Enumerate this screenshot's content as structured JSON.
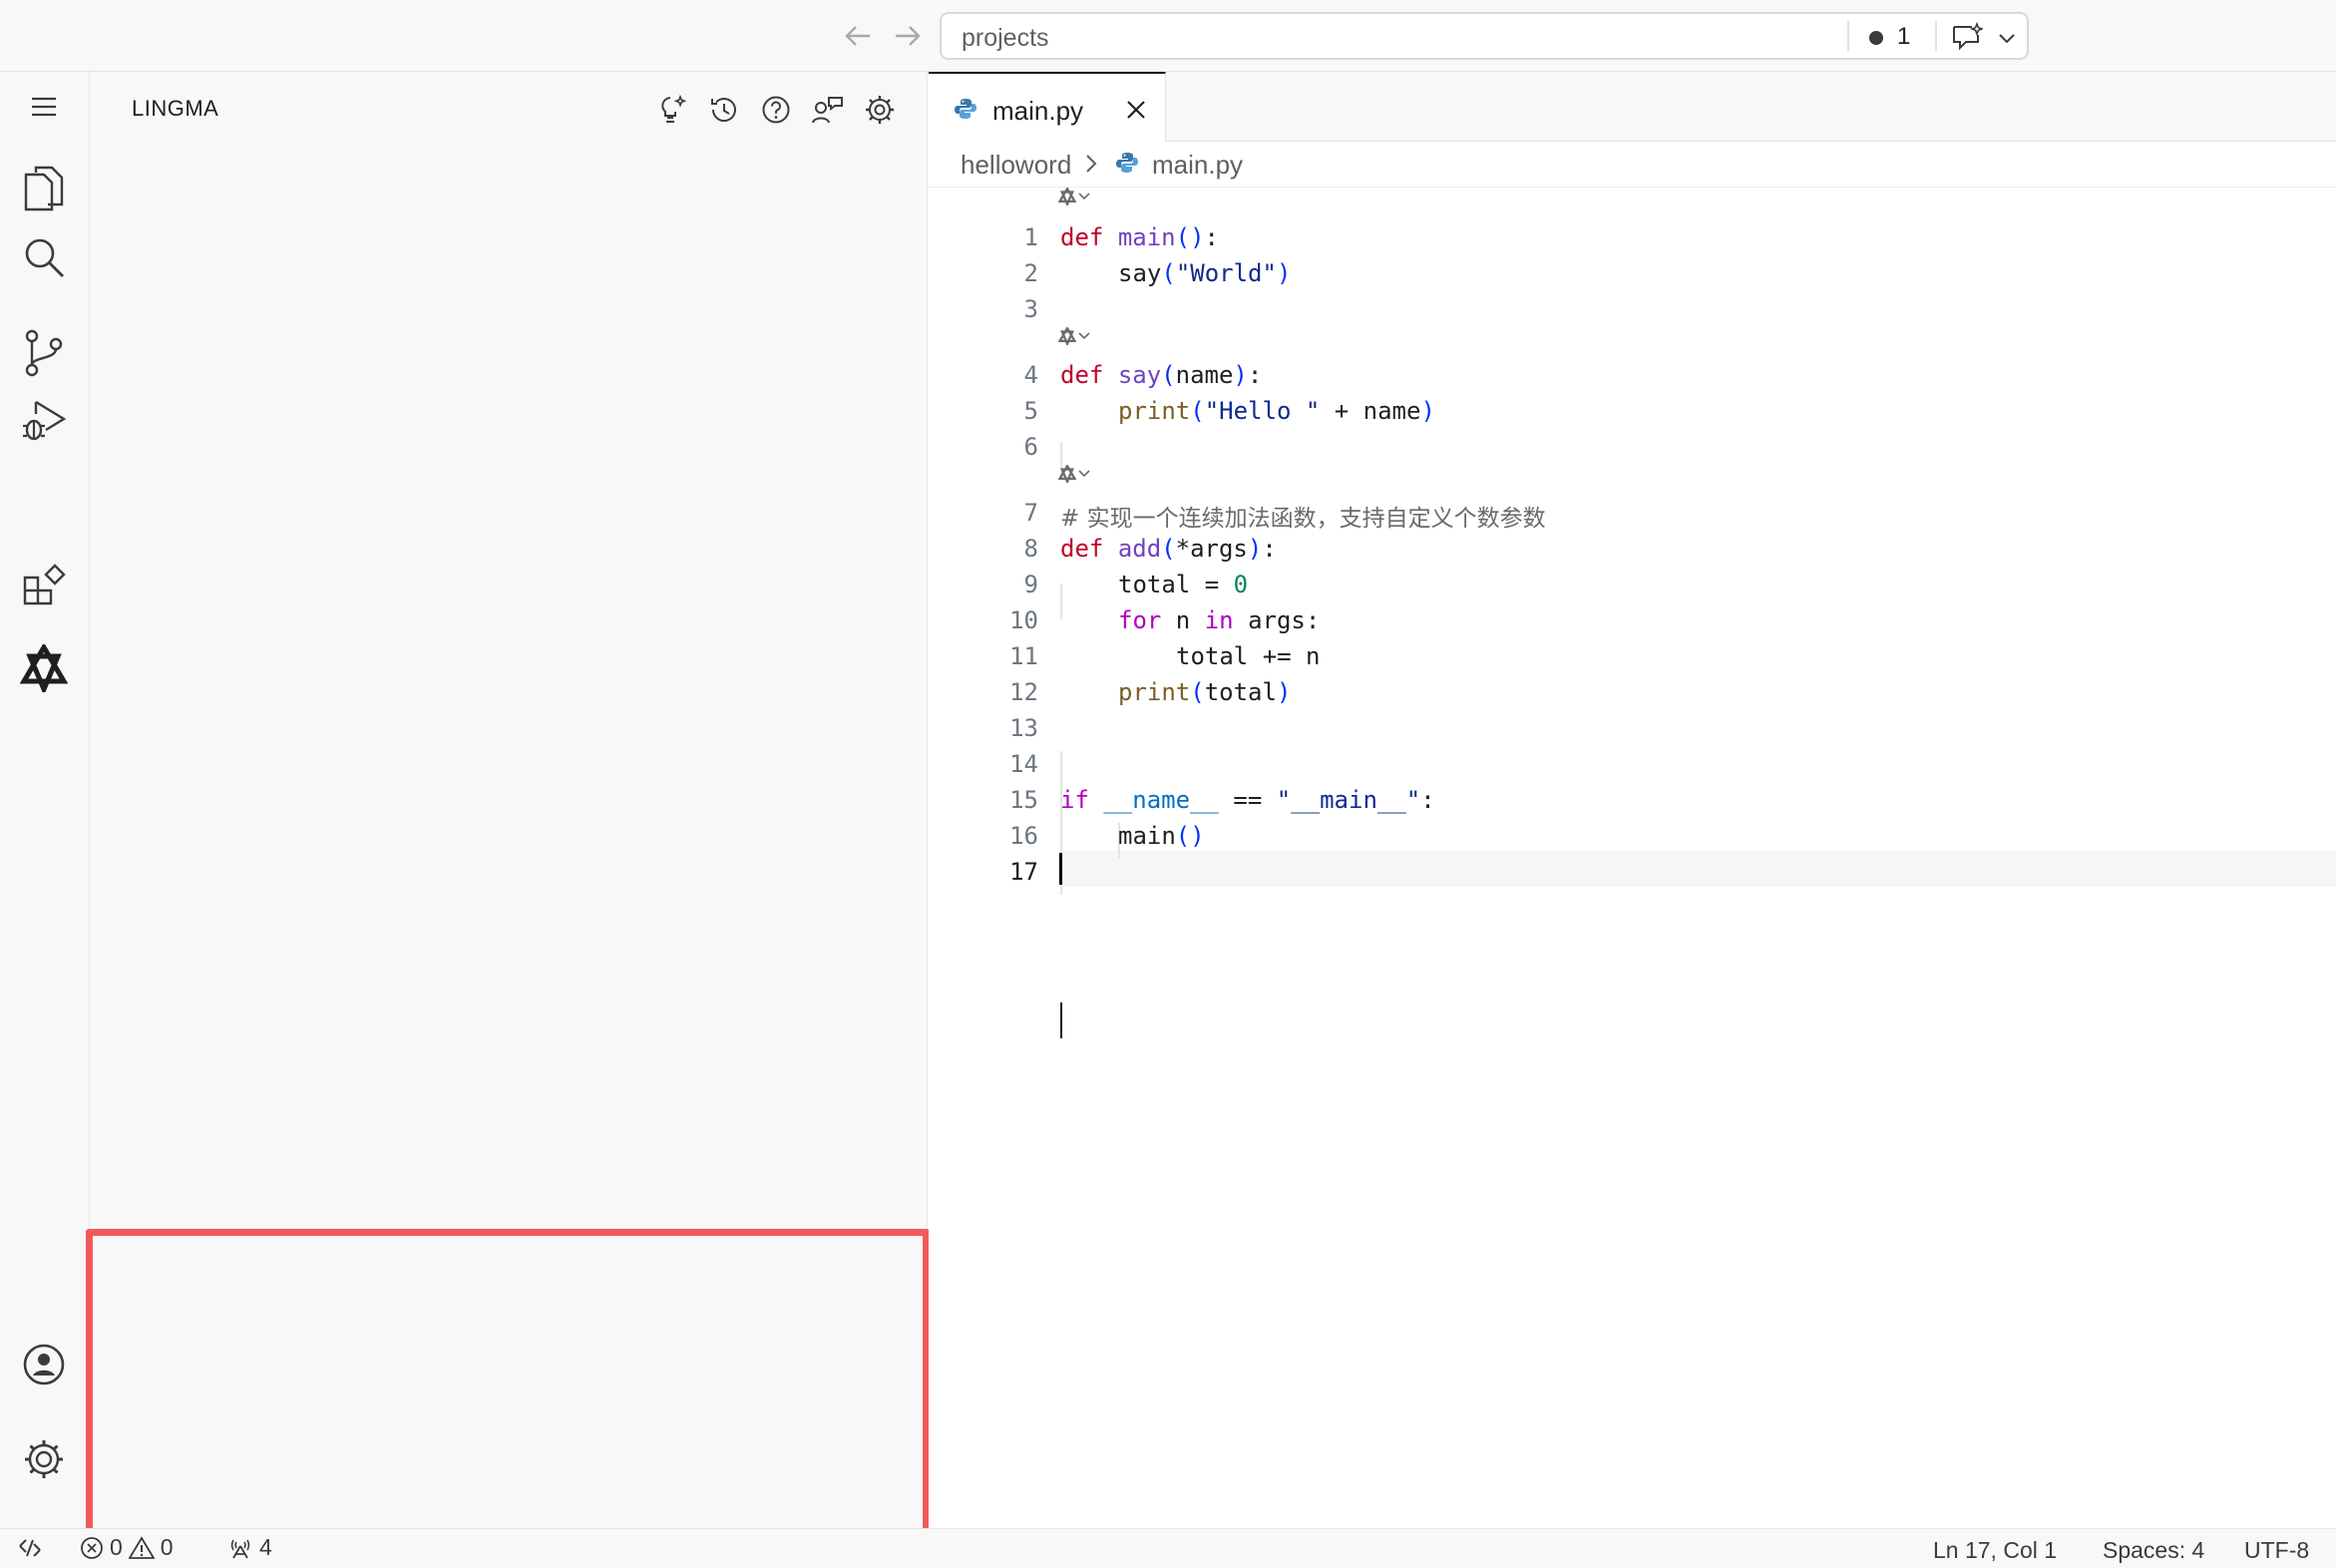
{
  "titlebar": {
    "command_center": "projects",
    "problems_count": "1"
  },
  "sidebar": {
    "title": "LINGMA"
  },
  "editor_tab": {
    "label": "main.py"
  },
  "breadcrumb": {
    "folder": "helloword",
    "file": "main.py"
  },
  "editor": {
    "line_numbers": [
      "1",
      "2",
      "3",
      "4",
      "5",
      "6",
      "7",
      "8",
      "9",
      "10",
      "11",
      "12",
      "13",
      "14",
      "15",
      "16",
      "17"
    ],
    "lines": {
      "l1": {
        "kw": "def",
        "fn": "main",
        "open": "(",
        "close": ")",
        "rest": ":"
      },
      "l2": {
        "fn": "say",
        "open": "(",
        "str": "\"World\"",
        "close": ")"
      },
      "l4": {
        "kw": "def",
        "fn": "say",
        "open": "(",
        "arg": "name",
        "close": ")",
        "rest": ":"
      },
      "l5": {
        "fn": "print",
        "open": "(",
        "str": "\"Hello \"",
        "rest": " + name",
        "close": ")"
      },
      "l7": {
        "comment": "# 实现一个连续加法函数，支持自定义个数参数"
      },
      "l8": {
        "kw": "def",
        "fn": "add",
        "open": "(",
        "arg": "*args",
        "close": ")",
        "rest": ":"
      },
      "l9": {
        "pre": "total = ",
        "num": "0"
      },
      "l10": {
        "kw": "for",
        "mid": " n ",
        "kw2": "in",
        "rest": " args:"
      },
      "l11": {
        "text": "total += n"
      },
      "l12": {
        "fn": "print",
        "open": "(",
        "arg": "total",
        "close": ")"
      },
      "l15": {
        "kw": "if",
        "sp": " ",
        "dunder": "__name__",
        "op": " == ",
        "str": "\"__main__\"",
        "rest": ":"
      },
      "l16": {
        "fn": "main",
        "open": "(",
        "close": ")"
      }
    }
  },
  "statusbar": {
    "errors": "0",
    "warnings": "0",
    "ports": "4",
    "position": "Ln 17, Col 1",
    "spaces": "Spaces: 4",
    "encoding": "UTF-8"
  },
  "colors": {
    "highlight_box": "#f25a5a",
    "keyword": "#c0002b",
    "string": "#0f2a8f",
    "number": "#098658"
  },
  "icons": {
    "activity": [
      "menu-icon",
      "explorer-icon",
      "search-icon",
      "source-control-icon",
      "run-debug-icon",
      "extensions-icon",
      "lingma-icon",
      "account-icon",
      "manage-gear-icon"
    ],
    "sidebar_actions": [
      "new-chat-sparkle-icon",
      "history-icon",
      "help-icon",
      "share-icon",
      "settings-icon"
    ]
  }
}
